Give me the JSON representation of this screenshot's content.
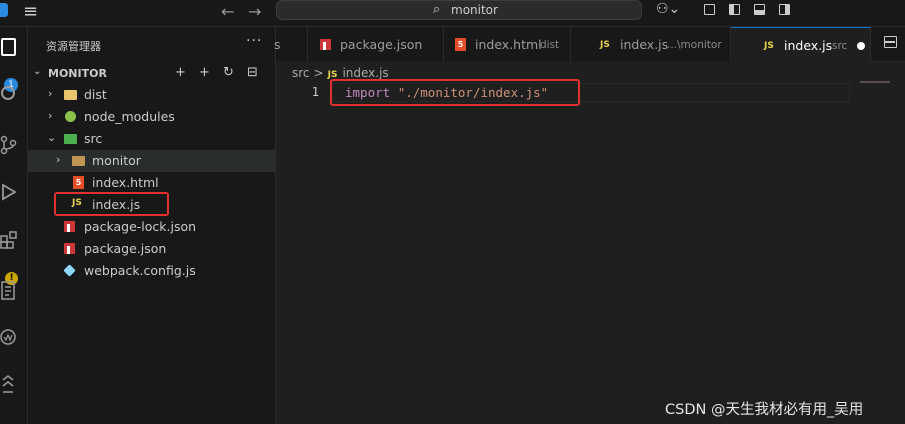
{
  "titlebar": {
    "menu_icon": "≡",
    "back_icon": "←",
    "forward_icon": "→",
    "search_icon": "⌕",
    "search_text": "monitor",
    "copilot_icon": "⚇⌄"
  },
  "activity_bar": {
    "explorer_badge": "1",
    "extensions_warning": "!"
  },
  "sidebar": {
    "title": "资源管理器",
    "more_icon": "···",
    "section_title": "MONITOR",
    "section_chevron": "⌄",
    "actions": {
      "new_file": "+",
      "new_folder": "+",
      "refresh": "↻",
      "collapse": "⊟"
    },
    "tree": [
      {
        "label": "dist",
        "chevron": "›"
      },
      {
        "label": "node_modules",
        "chevron": "›"
      },
      {
        "label": "src",
        "chevron": "⌄"
      },
      {
        "label": "monitor",
        "chevron": "›"
      },
      {
        "label": "index.html",
        "icon_text": "5"
      },
      {
        "label": "index.js",
        "icon_text": "JS"
      },
      {
        "label": "package-lock.json"
      },
      {
        "label": "package.json"
      },
      {
        "label": "webpack.config.js"
      }
    ]
  },
  "tabs": [
    {
      "label": "s"
    },
    {
      "label": "package.json"
    },
    {
      "label": "index.html",
      "desc": "dist",
      "icon_text": "5"
    },
    {
      "label": "index.js",
      "desc": "...\\monitor",
      "icon_text": "JS"
    },
    {
      "label": "index.js",
      "desc": "src",
      "icon_text": "JS"
    }
  ],
  "breadcrumb": {
    "folder": "src",
    "sep": ">",
    "icon_text": "JS",
    "file": "index.js"
  },
  "editor": {
    "line_number": "1",
    "keyword": "import",
    "string": "\"./monitor/index.js\""
  },
  "watermark": "CSDN @天生我材必有用_吴用",
  "colors": {
    "accent": "#0078d4",
    "highlight_box": "#e03030",
    "keyword": "#c586c0",
    "string": "#ce9178",
    "js_icon": "#e8d44d"
  }
}
